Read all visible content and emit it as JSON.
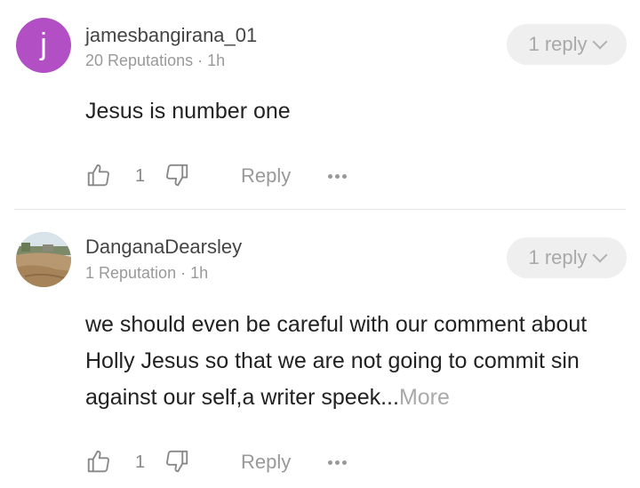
{
  "comments": [
    {
      "avatar_letter": "j",
      "avatar_color": "#b24fc4",
      "username": "jamesbangirana_01",
      "meta": "20 Reputations · 1h",
      "reply_pill": "1 reply",
      "text": "Jesus is  number one",
      "likes": "1",
      "reply_label": "Reply"
    },
    {
      "avatar_icon": "landscape-photo-avatar",
      "username": "DanganaDearsley",
      "meta": "1 Reputation · 1h",
      "reply_pill": "1 reply",
      "text": "we should even be careful with our comment about Holly Jesus  so that we are not going to commit sin against our self,a writer speek...",
      "more_label": "More",
      "likes": "1",
      "reply_label": "Reply"
    }
  ],
  "icons": {
    "like": "thumbs-up-icon",
    "dislike": "thumbs-down-icon",
    "menu": "more-dots-icon",
    "expand": "chevron-down-icon"
  }
}
